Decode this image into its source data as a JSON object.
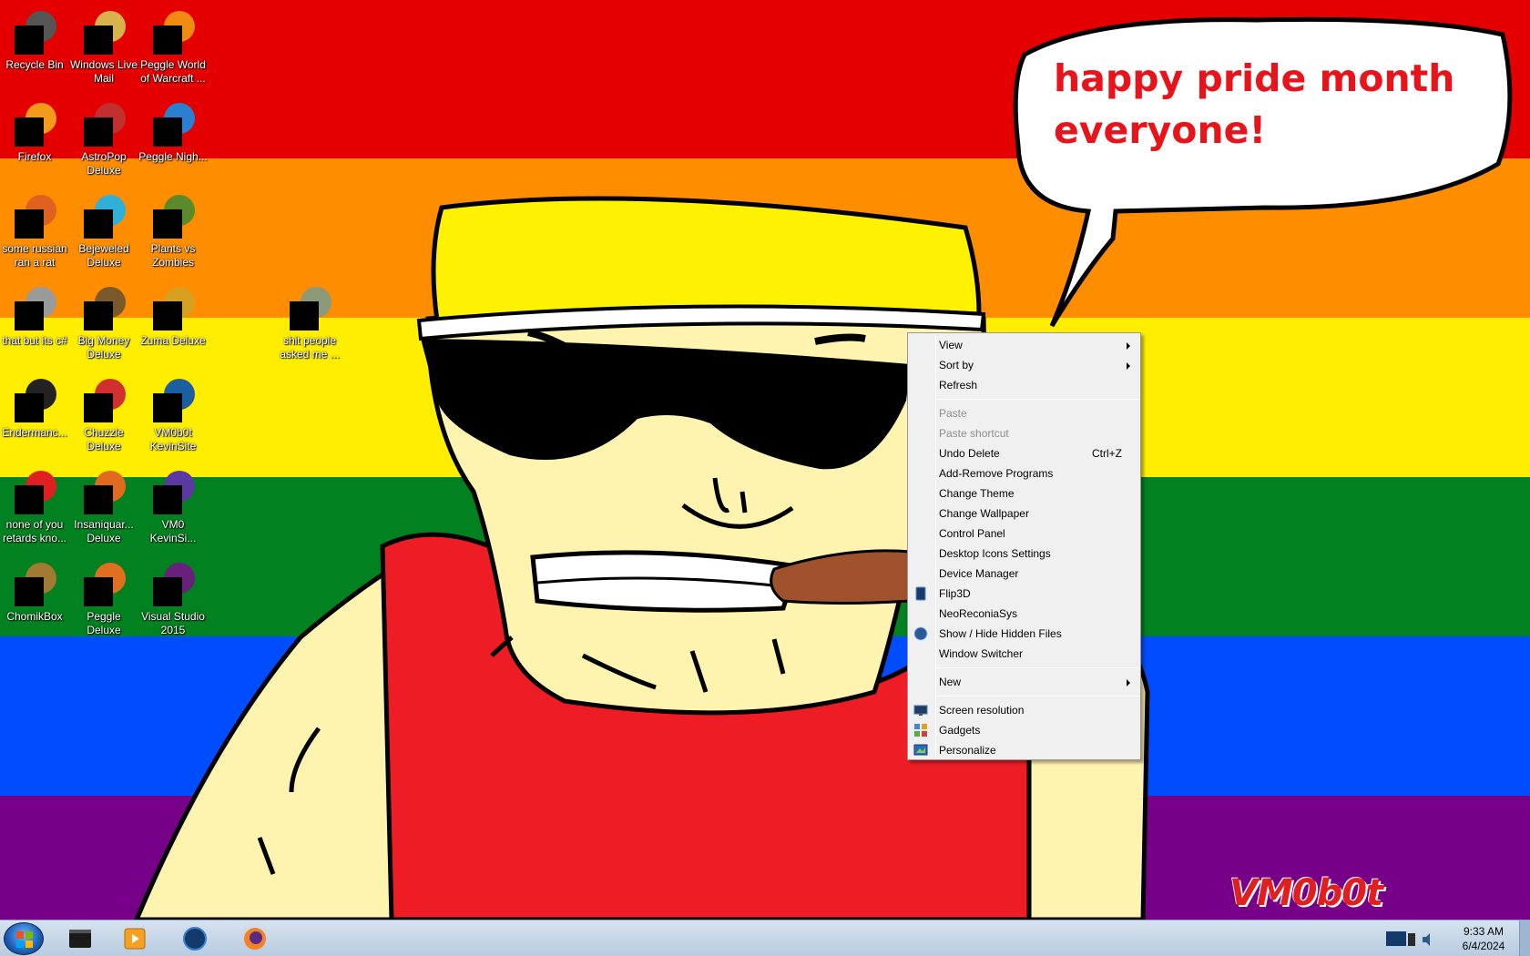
{
  "wallpaper": {
    "stripes": [
      "#e50000",
      "#ff8d00",
      "#ffee00",
      "#028121",
      "#004cff",
      "#770088"
    ],
    "bubble_text_lines": [
      "happy pride month",
      "everyone!"
    ],
    "signature": "VM0b0t"
  },
  "desktop_icons": [
    {
      "label": "Recycle Bin",
      "icon": "recycle-bin-icon",
      "accent": "#555555"
    },
    {
      "label": "Windows Live Mail",
      "icon": "mail-icon",
      "accent": "#d8b24a"
    },
    {
      "label": "Peggle World of Warcraft ...",
      "icon": "peggle-icon",
      "accent": "#f08a10"
    },
    {
      "label": "Firefox",
      "icon": "firefox-icon",
      "accent": "#f59a1b"
    },
    {
      "label": "AstroPop Deluxe",
      "icon": "astropop-icon",
      "accent": "#c03030"
    },
    {
      "label": "Peggle Nigh...",
      "icon": "peggle-nights-icon",
      "accent": "#2a7fd0"
    },
    {
      "label": "some russian ran a rat",
      "icon": "ie-icon",
      "accent": "#e06020"
    },
    {
      "label": "Bejeweled Deluxe",
      "icon": "bejeweled-icon",
      "accent": "#2fb0d8"
    },
    {
      "label": "Plants vs Zombies",
      "icon": "pvz-icon",
      "accent": "#5c8a2a"
    },
    {
      "label": "that but its c#",
      "icon": "window-stack-icon",
      "accent": "#9a9a9a"
    },
    {
      "label": "Big Money Deluxe",
      "icon": "money-icon",
      "accent": "#7a5a2a"
    },
    {
      "label": "Zuma Deluxe",
      "icon": "zuma-icon",
      "accent": "#d8a020"
    },
    {
      "label": "shit people asked me ...",
      "icon": "folder-icon",
      "accent": "#8a9a7a"
    },
    {
      "label": "Endermanc...",
      "icon": "terminal-icon",
      "accent": "#222222"
    },
    {
      "label": "Chuzzle Deluxe",
      "icon": "chuzzle-icon",
      "accent": "#d03030"
    },
    {
      "label": "VM0b0t KevinSite",
      "icon": "monitor-icon",
      "accent": "#1c5fa0"
    },
    {
      "label": "none of you retards kno...",
      "icon": "pokeball-icon",
      "accent": "#e02020"
    },
    {
      "label": "Insaniquar... Deluxe",
      "icon": "fish-icon",
      "accent": "#e06a20"
    },
    {
      "label": "VM0 KevinSi...",
      "icon": "app-icon",
      "accent": "#5a3aa0"
    },
    {
      "label": "ChomikBox",
      "icon": "chomikbox-icon",
      "accent": "#a07a30"
    },
    {
      "label": "Peggle Deluxe",
      "icon": "peggle-deluxe-icon",
      "accent": "#e07020"
    },
    {
      "label": "Visual Studio 2015",
      "icon": "visual-studio-icon",
      "accent": "#68217a"
    }
  ],
  "context_menu": {
    "items": [
      {
        "label": "View",
        "submenu": true
      },
      {
        "label": "Sort by",
        "submenu": true
      },
      {
        "label": "Refresh"
      },
      {
        "label": "Paste",
        "disabled": true
      },
      {
        "label": "Paste shortcut",
        "disabled": true
      },
      {
        "label": "Undo Delete",
        "shortcut": "Ctrl+Z"
      },
      {
        "label": "Add-Remove Programs"
      },
      {
        "label": "Change Theme"
      },
      {
        "label": "Change Wallpaper"
      },
      {
        "label": "Control Panel"
      },
      {
        "label": "Desktop Icons Settings"
      },
      {
        "label": "Device Manager"
      },
      {
        "label": "Flip3D",
        "icon": "flip3d-icon"
      },
      {
        "label": "NeoReconiaSys"
      },
      {
        "label": "Show / Hide Hidden Files",
        "icon": "globe-icon"
      },
      {
        "label": "Window Switcher"
      },
      {
        "label": "New",
        "submenu": true
      },
      {
        "label": "Screen resolution",
        "icon": "screen-resolution-icon"
      },
      {
        "label": "Gadgets",
        "icon": "gadgets-icon"
      },
      {
        "label": "Personalize",
        "icon": "personalize-icon"
      }
    ]
  },
  "taskbar": {
    "pinned": [
      "terminal-icon",
      "media-player-icon",
      "globe-icon",
      "firefox-icon"
    ],
    "clock_time": "9:33 AM",
    "clock_date": "6/4/2024"
  }
}
